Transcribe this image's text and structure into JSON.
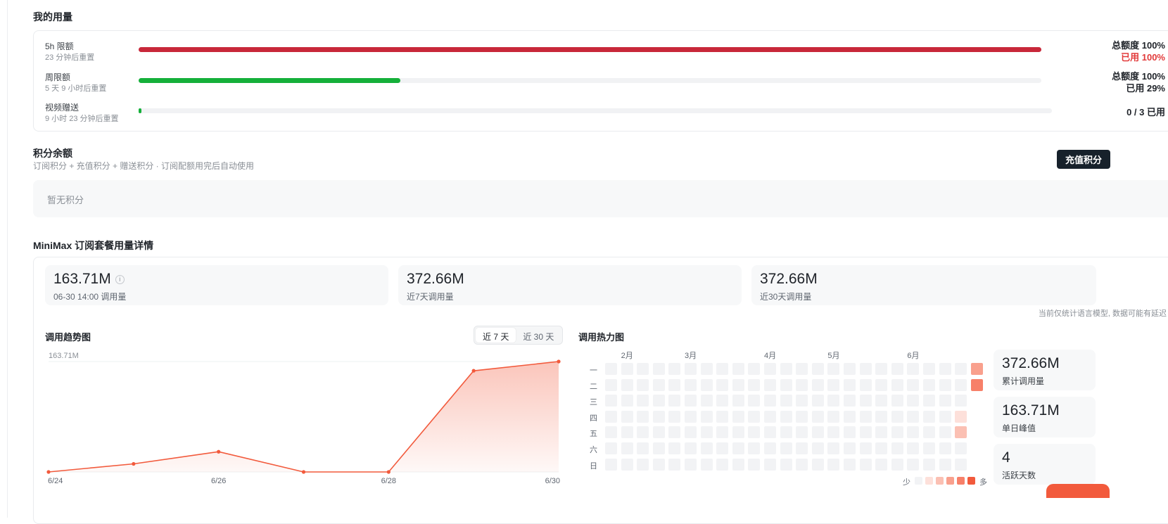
{
  "usage": {
    "title": "我的用量",
    "rows": [
      {
        "name": "5h 限额",
        "sub": "23 分钟后重置",
        "total": "总额度 100%",
        "used": "已用 100%",
        "ratio": 1.0,
        "color": "#c8283a",
        "used_red": true
      },
      {
        "name": "周限额",
        "sub": "5 天 9 小时后重置",
        "total": "总额度 100%",
        "used": "已用 29%",
        "ratio": 0.29,
        "color": "#15b03a",
        "used_red": false
      },
      {
        "name": "视频赠送",
        "sub": "9 小时 23 分钟后重置",
        "total": "0 / 3 已用",
        "used": "",
        "ratio": 0.0,
        "color": "#15b03a",
        "used_red": false
      }
    ]
  },
  "credits": {
    "title": "积分余额",
    "subtitle": "订阅积分 + 充值积分 + 赠送积分 · 订阅配额用完后自动使用",
    "recharge_label": "充值积分",
    "empty": "暂无积分"
  },
  "detail": {
    "title": "MiniMax 订阅套餐用量详情",
    "stats": [
      {
        "value": "163.71M",
        "label": "06-30 14:00 调用量",
        "info": "i"
      },
      {
        "value": "372.66M",
        "label": "近7天调用量"
      },
      {
        "value": "372.66M",
        "label": "近30天调用量"
      }
    ],
    "note": "当前仅统计语言模型, 数据可能有延迟"
  },
  "trend": {
    "title": "调用趋势图",
    "tabs": [
      "近 7 天",
      "近 30 天"
    ],
    "active_tab": 0
  },
  "chart_data": {
    "type": "area",
    "title": "调用趋势图",
    "x": [
      "6/24",
      "6/25",
      "6/26",
      "6/27",
      "6/28",
      "6/29",
      "6/30"
    ],
    "x_tick_labels": [
      "6/24",
      "6/26",
      "6/28",
      "6/30"
    ],
    "series": [
      {
        "values": [
          0,
          12,
          30,
          0,
          0,
          150,
          163.71
        ]
      }
    ],
    "ylim": [
      0,
      163.71
    ],
    "y_tick_label": "163.71M",
    "unit": "M",
    "color": "#f25a3c"
  },
  "heatmap": {
    "title": "调用热力图",
    "months": [
      "2月",
      "3月",
      "4月",
      "5月",
      "6月"
    ],
    "weekdays": [
      "一",
      "二",
      "三",
      "四",
      "五",
      "六",
      "日"
    ],
    "legend_less": "少",
    "legend_more": "多",
    "active_cells": [
      {
        "col": 23,
        "row": 0,
        "level": 3
      },
      {
        "col": 23,
        "row": 1,
        "level": 4
      },
      {
        "col": 22,
        "row": 3,
        "level": 1
      },
      {
        "col": 22,
        "row": 4,
        "level": 2
      }
    ],
    "level_colors": [
      "#f2f3f5",
      "#fde0da",
      "#fbc0b3",
      "#f9a08d",
      "#f78069",
      "#f25a3c"
    ],
    "summary": [
      {
        "value": "372.66M",
        "label": "累计调用量"
      },
      {
        "value": "163.71M",
        "label": "单日峰值"
      },
      {
        "value": "4",
        "label": "活跃天数"
      }
    ]
  }
}
